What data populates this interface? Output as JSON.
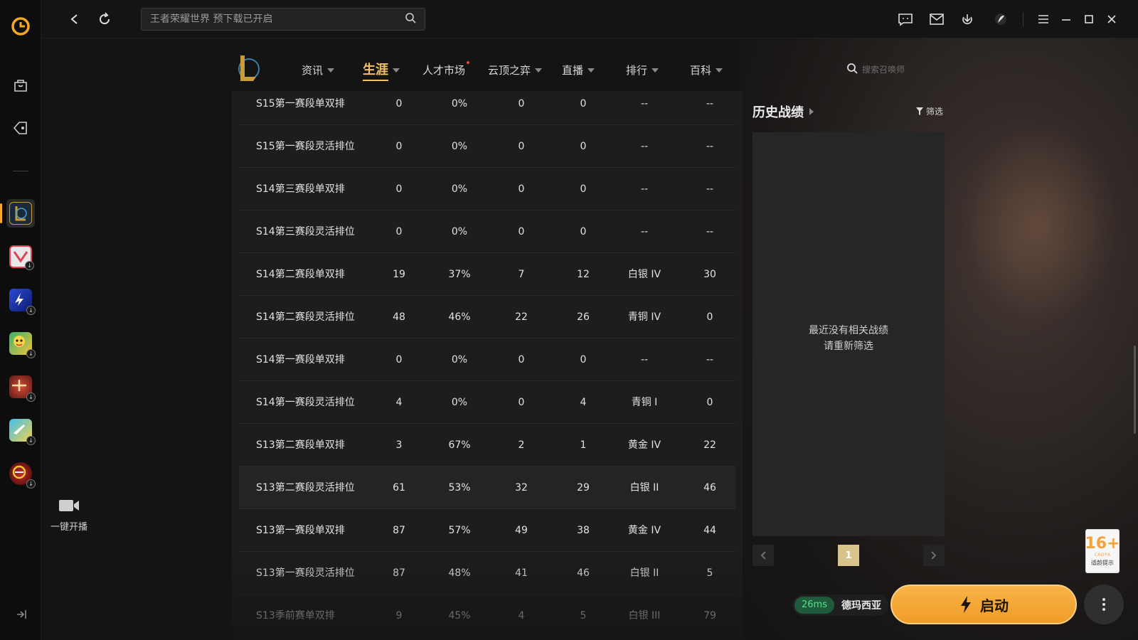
{
  "topbar": {
    "search_placeholder": "王者荣耀世界 预下载已开启"
  },
  "game_nav": {
    "items": [
      {
        "label": "资讯"
      },
      {
        "label": "生涯"
      },
      {
        "label": "人才市场"
      },
      {
        "label": "云顶之弈"
      },
      {
        "label": "直播"
      },
      {
        "label": "排行"
      },
      {
        "label": "百科"
      }
    ],
    "active": "生涯",
    "search_placeholder": "搜索召唤师"
  },
  "rank_table": {
    "rows": [
      {
        "season": "S15第一赛段单双排",
        "games": "0",
        "winrate": "0%",
        "wins": "0",
        "losses": "0",
        "tier": "--",
        "points": "--"
      },
      {
        "season": "S15第一赛段灵活排位",
        "games": "0",
        "winrate": "0%",
        "wins": "0",
        "losses": "0",
        "tier": "--",
        "points": "--"
      },
      {
        "season": "S14第三赛段单双排",
        "games": "0",
        "winrate": "0%",
        "wins": "0",
        "losses": "0",
        "tier": "--",
        "points": "--"
      },
      {
        "season": "S14第三赛段灵活排位",
        "games": "0",
        "winrate": "0%",
        "wins": "0",
        "losses": "0",
        "tier": "--",
        "points": "--"
      },
      {
        "season": "S14第二赛段单双排",
        "games": "19",
        "winrate": "37%",
        "wins": "7",
        "losses": "12",
        "tier": "白银 IV",
        "points": "30"
      },
      {
        "season": "S14第二赛段灵活排位",
        "games": "48",
        "winrate": "46%",
        "wins": "22",
        "losses": "26",
        "tier": "青铜 IV",
        "points": "0"
      },
      {
        "season": "S14第一赛段单双排",
        "games": "0",
        "winrate": "0%",
        "wins": "0",
        "losses": "0",
        "tier": "--",
        "points": "--"
      },
      {
        "season": "S14第一赛段灵活排位",
        "games": "4",
        "winrate": "0%",
        "wins": "0",
        "losses": "4",
        "tier": "青铜 I",
        "points": "0"
      },
      {
        "season": "S13第二赛段单双排",
        "games": "3",
        "winrate": "67%",
        "wins": "2",
        "losses": "1",
        "tier": "黄金 IV",
        "points": "22"
      },
      {
        "season": "S13第二赛段灵活排位",
        "games": "61",
        "winrate": "53%",
        "wins": "32",
        "losses": "29",
        "tier": "白银 II",
        "points": "46"
      },
      {
        "season": "S13第一赛段单双排",
        "games": "87",
        "winrate": "57%",
        "wins": "49",
        "losses": "38",
        "tier": "黄金 IV",
        "points": "44"
      },
      {
        "season": "S13第一赛段灵活排位",
        "games": "87",
        "winrate": "48%",
        "wins": "41",
        "losses": "46",
        "tier": "白银 II",
        "points": "5"
      },
      {
        "season": "S13季前赛单双排",
        "games": "9",
        "winrate": "45%",
        "wins": "4",
        "losses": "5",
        "tier": "白银 III",
        "points": "79"
      }
    ]
  },
  "history": {
    "title": "历史战绩",
    "filter_label": "筛选",
    "empty_line1": "最近没有相关战绩",
    "empty_line2": "请重新筛选",
    "page": "1"
  },
  "live": {
    "label": "一键开播"
  },
  "launch": {
    "ping": "26ms",
    "server": "德玛西亚",
    "button_label": "启动"
  },
  "age_rating": {
    "rating": "16+",
    "org": "CADPA",
    "tip": "适龄提示"
  },
  "colors": {
    "accent": "#f0c266",
    "launch": "#f3a830",
    "ping_green": "#56e08c"
  }
}
